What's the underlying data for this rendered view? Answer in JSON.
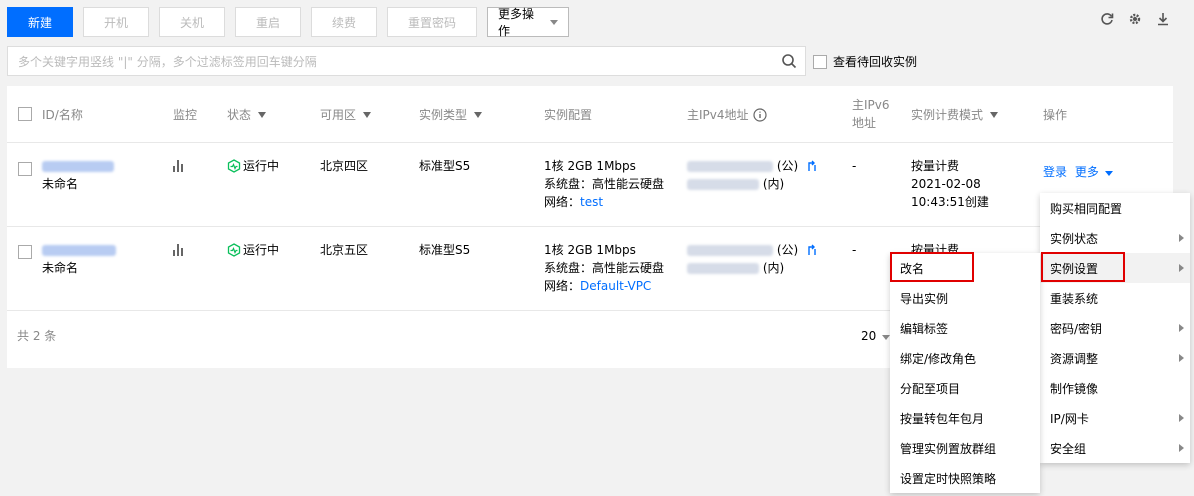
{
  "toolbar": {
    "new": "新建",
    "start": "开机",
    "stop": "关机",
    "restart": "重启",
    "renew": "续费",
    "reset_password": "重置密码",
    "more_actions": "更多操作"
  },
  "search": {
    "placeholder": "多个关键字用竖线 \"|\" 分隔，多个过滤标签用回车键分隔",
    "recycle_label": "查看待回收实例"
  },
  "table": {
    "headers": {
      "id_name": "ID/名称",
      "monitor": "监控",
      "status": "状态",
      "zone": "可用区",
      "type": "实例类型",
      "config": "实例配置",
      "ipv4": "主IPv4地址",
      "ipv6_line1": "主IPv6",
      "ipv6_line2": "地址",
      "billing": "实例计费模式",
      "actions": "操作"
    },
    "rows": [
      {
        "name": "未命名",
        "status": "运行中",
        "zone": "北京四区",
        "type": "标准型S5",
        "config_line1": "1核 2GB 1Mbps",
        "config_line2": "系统盘：高性能云硬盘",
        "network_label": "网络：",
        "network": "test",
        "public_suffix": "(公)",
        "private_suffix": "(内)",
        "ipv6": "-",
        "billing": "按量计费",
        "created_date": "2021-02-08",
        "created_time": "10:43:51创建",
        "login": "登录",
        "more": "更多"
      },
      {
        "name": "未命名",
        "status": "运行中",
        "zone": "北京五区",
        "type": "标准型S5",
        "config_line1": "1核 2GB 1Mbps",
        "config_line2": "系统盘：高性能云硬盘",
        "network_label": "网络：",
        "network": "Default-VPC",
        "public_suffix": "(公)",
        "private_suffix": "(内)",
        "ipv6": "-",
        "billing": "按量计费"
      }
    ],
    "footer": {
      "total": "共 2 条",
      "page_size": "20"
    }
  },
  "menu_primary": [
    "购买相同配置",
    "实例状态",
    "实例设置",
    "重装系统",
    "密码/密钥",
    "资源调整",
    "制作镜像",
    "IP/网卡",
    "安全组"
  ],
  "menu_secondary": [
    "改名",
    "导出实例",
    "编辑标签",
    "绑定/修改角色",
    "分配至项目",
    "按量转包年包月",
    "管理实例置放群组",
    "设置定时快照策略"
  ],
  "colors": {
    "primary": "#006eff",
    "status_green": "#0abf5b",
    "highlight_red": "#e00000"
  }
}
